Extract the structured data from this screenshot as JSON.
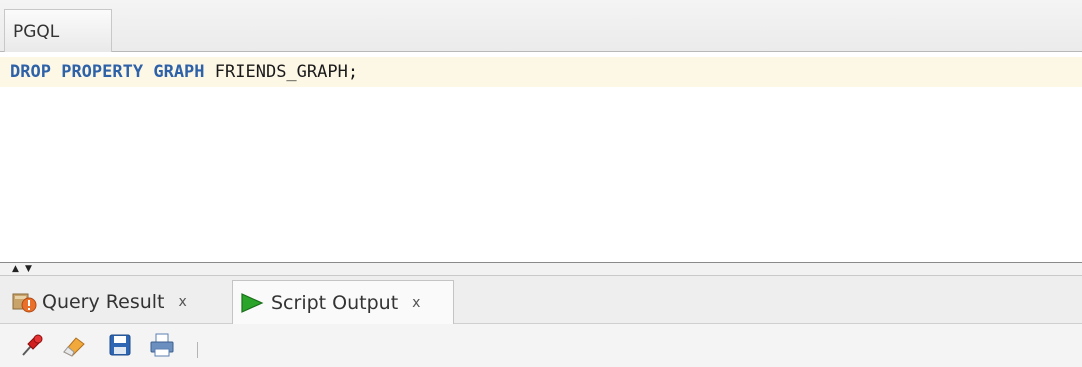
{
  "editor": {
    "tab_label": "PGQL",
    "code": {
      "keywords": [
        "DROP",
        "PROPERTY",
        "GRAPH"
      ],
      "identifier": "FRIENDS_GRAPH;"
    }
  },
  "splitter": {
    "up_glyph": "▲",
    "down_glyph": "▼"
  },
  "bottom_panel": {
    "tabs": [
      {
        "label": "Query Result",
        "close": "x",
        "icon": "query-result-icon",
        "active": false
      },
      {
        "label": "Script Output",
        "close": "x",
        "icon": "run-script-icon",
        "active": true
      }
    ],
    "toolbar": [
      {
        "icon": "pin-icon"
      },
      {
        "icon": "eraser-icon"
      },
      {
        "icon": "save-icon"
      },
      {
        "icon": "print-icon"
      }
    ]
  },
  "colors": {
    "keyword": "#2e62a8",
    "current_line": "#fdf7e6",
    "run_green": "#2aa52a"
  }
}
